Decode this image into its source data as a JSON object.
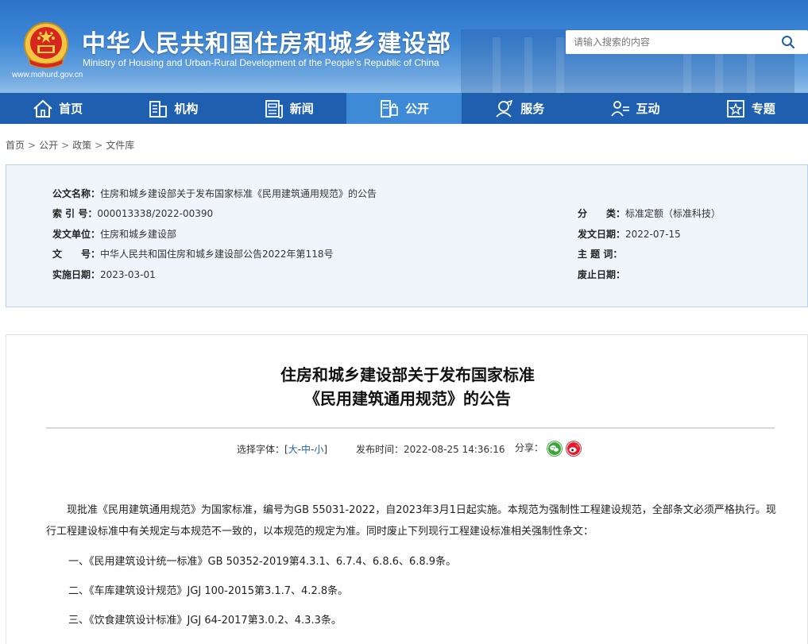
{
  "header": {
    "site_url": "www.mohurd.gov.cn",
    "title": "中华人民共和国住房和城乡建设部",
    "subtitle": "Ministry of Housing and Urban-Rural Development of the People’s Republic of China",
    "search_placeholder": "请输入搜索的内容",
    "search_icon": "search-icon",
    "brand_color": "#1f5fb0",
    "active_color": "#3f8ad6"
  },
  "nav": {
    "items": [
      {
        "label": "首页",
        "icon": "home-icon"
      },
      {
        "label": "机构",
        "icon": "building-icon"
      },
      {
        "label": "新闻",
        "icon": "newspaper-icon"
      },
      {
        "label": "公开",
        "icon": "document-icon",
        "active": true
      },
      {
        "label": "服务",
        "icon": "service-icon"
      },
      {
        "label": "互动",
        "icon": "interaction-icon"
      },
      {
        "label": "专题",
        "icon": "star-icon"
      }
    ]
  },
  "breadcrumb": [
    "首页",
    "公开",
    "政策",
    "文件库"
  ],
  "breadcrumb_sep": ">",
  "info": {
    "doc_name_label": "公文名称：",
    "doc_name": "住房和城乡建设部关于发布国家标准《民用建筑通用规范》的公告",
    "index_label": "索 引 号：",
    "index": "000013338/2022-00390",
    "category_label": "分　　类：",
    "category": "标准定额（标准科技）",
    "issuer_label": "发文单位：",
    "issuer": "住房和城乡建设部",
    "issue_date_label": "发文日期：",
    "issue_date": "2022-07-15",
    "doc_no_label": "文　　号：",
    "doc_no": "中华人民共和国住房和城乡建设部公告2022年第118号",
    "subject_label": "主 题 词：",
    "subject": "",
    "effective_label": "实施日期：",
    "effective": "2023-03-01",
    "expiry_label": "废止日期：",
    "expiry": ""
  },
  "article": {
    "title_line1": "住房和城乡建设部关于发布国家标准",
    "title_line2": "《民用建筑通用规范》的公告",
    "font_size_label": "选择字体：[",
    "font_large": "大",
    "font_medium": "中",
    "font_small": "小",
    "font_dash": "-",
    "font_close": "]",
    "publish_time_label": "发布时间：",
    "publish_time": "2022-08-25 14:36:16",
    "share_label": "分享：",
    "share_icons": [
      "wechat-icon",
      "weibo-icon"
    ],
    "paragraph": "现批准《民用建筑通用规范》为国家标准，编号为GB 55031-2022，自2023年3月1日起实施。本规范为强制性工程建设规范，全部条文必须严格执行。现行工程建设标准中有关规定与本规范不一致的，以本规范的规定为准。同时废止下列现行工程建设标准相关强制性条文：",
    "list": [
      "一、《民用建筑设计统一标准》GB 50352-2019第4.3.1、6.7.4、6.8.6、6.8.9条。",
      "二、《车库建筑设计规范》JGJ 100-2015第3.1.7、4.2.8条。",
      "三、《饮食建筑设计标准》JGJ 64-2017第3.0.2、4.3.3条。"
    ]
  }
}
